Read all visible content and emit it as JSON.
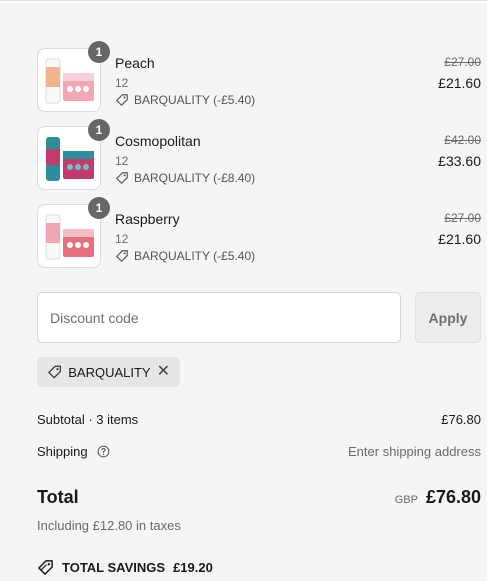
{
  "line_items": [
    {
      "name": "Peach",
      "quantity": "1",
      "variant": "12",
      "discount": "BARQUALITY (-£5.40)",
      "original_price": "£27.00",
      "price": "£21.60",
      "can_color": "#f1b48c",
      "pack_color": "#f2a7b5"
    },
    {
      "name": "Cosmopolitan",
      "quantity": "1",
      "variant": "12",
      "discount": "BARQUALITY (-£8.40)",
      "original_price": "£42.00",
      "price": "£33.60",
      "can_color": "#2c8d9c",
      "pack_color": "#c23b6c"
    },
    {
      "name": "Raspberry",
      "quantity": "1",
      "variant": "12",
      "discount": "BARQUALITY (-£5.40)",
      "original_price": "£27.00",
      "price": "£21.60",
      "can_color": "#f0a6b3",
      "pack_color": "#e8707c"
    }
  ],
  "discount_form": {
    "placeholder": "Discount code",
    "apply_label": "Apply"
  },
  "applied_code": {
    "code": "BARQUALITY"
  },
  "summary": {
    "subtotal_label": "Subtotal · 3 items",
    "subtotal_value": "£76.80",
    "shipping_label": "Shipping",
    "shipping_value": "Enter shipping address"
  },
  "total": {
    "label": "Total",
    "currency": "GBP",
    "amount": "£76.80",
    "taxes_note": "Including £12.80 in taxes"
  },
  "savings": {
    "label": "TOTAL SAVINGS",
    "amount": "£19.20"
  },
  "icons": {
    "tag": "tag-icon",
    "help": "question-circle-icon",
    "close": "close-icon"
  }
}
